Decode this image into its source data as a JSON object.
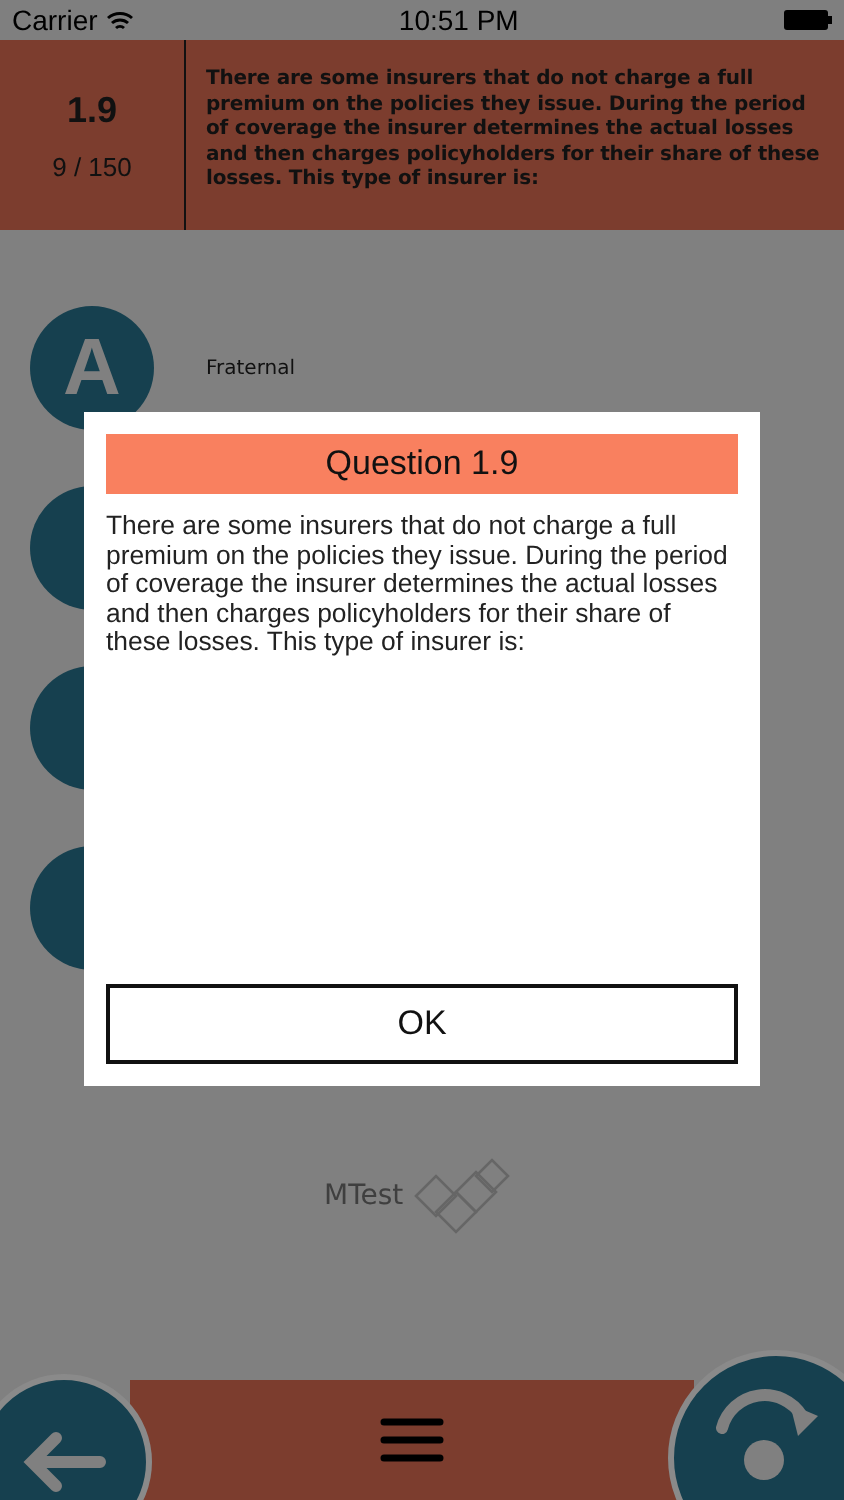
{
  "status_bar": {
    "carrier": "Carrier",
    "time": "10:51 PM"
  },
  "header": {
    "number": "1.9",
    "progress": "9 / 150",
    "question": "There are some insurers that do not charge a full premium on the policies they issue. During the period of coverage the insurer determines the actual losses and then charges policyholders for their share of these losses. This type of insurer is:"
  },
  "answers": [
    {
      "letter": "A",
      "text": "Fraternal"
    }
  ],
  "logo": {
    "text": "MTest"
  },
  "dialog": {
    "title": "Question 1.9",
    "body": "There are some insurers that do not charge a full premium on the policies they issue. During the period of coverage the insurer determines the actual losses and then charges policyholders for their share of these losses. This type of insurer is:",
    "button": "OK"
  }
}
